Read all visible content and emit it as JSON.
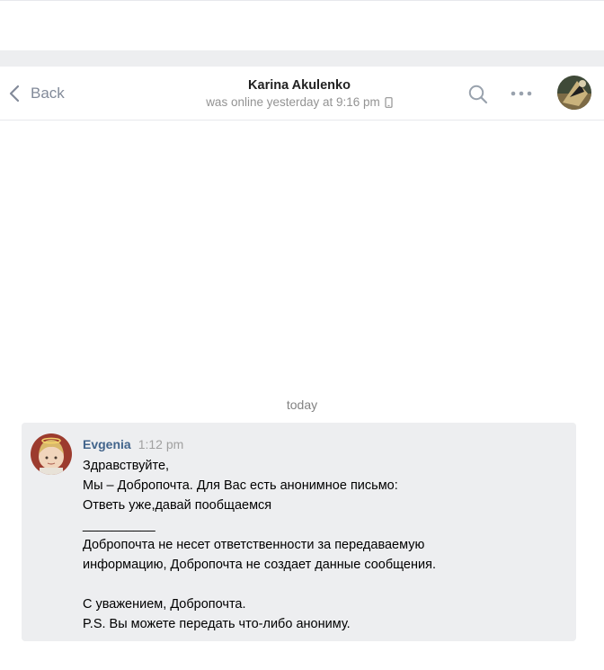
{
  "header": {
    "back_label": "Back",
    "peer_name": "Karina Akulenko",
    "peer_status": "was online yesterday at 9:16 pm",
    "icons": {
      "back": "chevron-left-icon",
      "search": "search-icon",
      "more": "more-horizontal-icon",
      "status_device": "mobile-phone-icon"
    }
  },
  "history": {
    "date_separator": "today"
  },
  "message": {
    "author": "Evgenia",
    "time": "1:12 pm",
    "lines": [
      "Здравствуйте,",
      "Мы – Добропочта. Для Вас есть анонимное письмо:",
      "Ответь уже,давай пообщаемся",
      "__________",
      "Добропочта не несет ответственности за передаваемую",
      "информацию, Добропочта не создает данные сообщения.",
      "",
      "С уважением, Добропочта.",
      "P.S. Вы можете передать что-либо анониму."
    ]
  },
  "colors": {
    "author_link": "#42648b",
    "message_background": "#edeef0",
    "muted_text": "#828a99"
  }
}
